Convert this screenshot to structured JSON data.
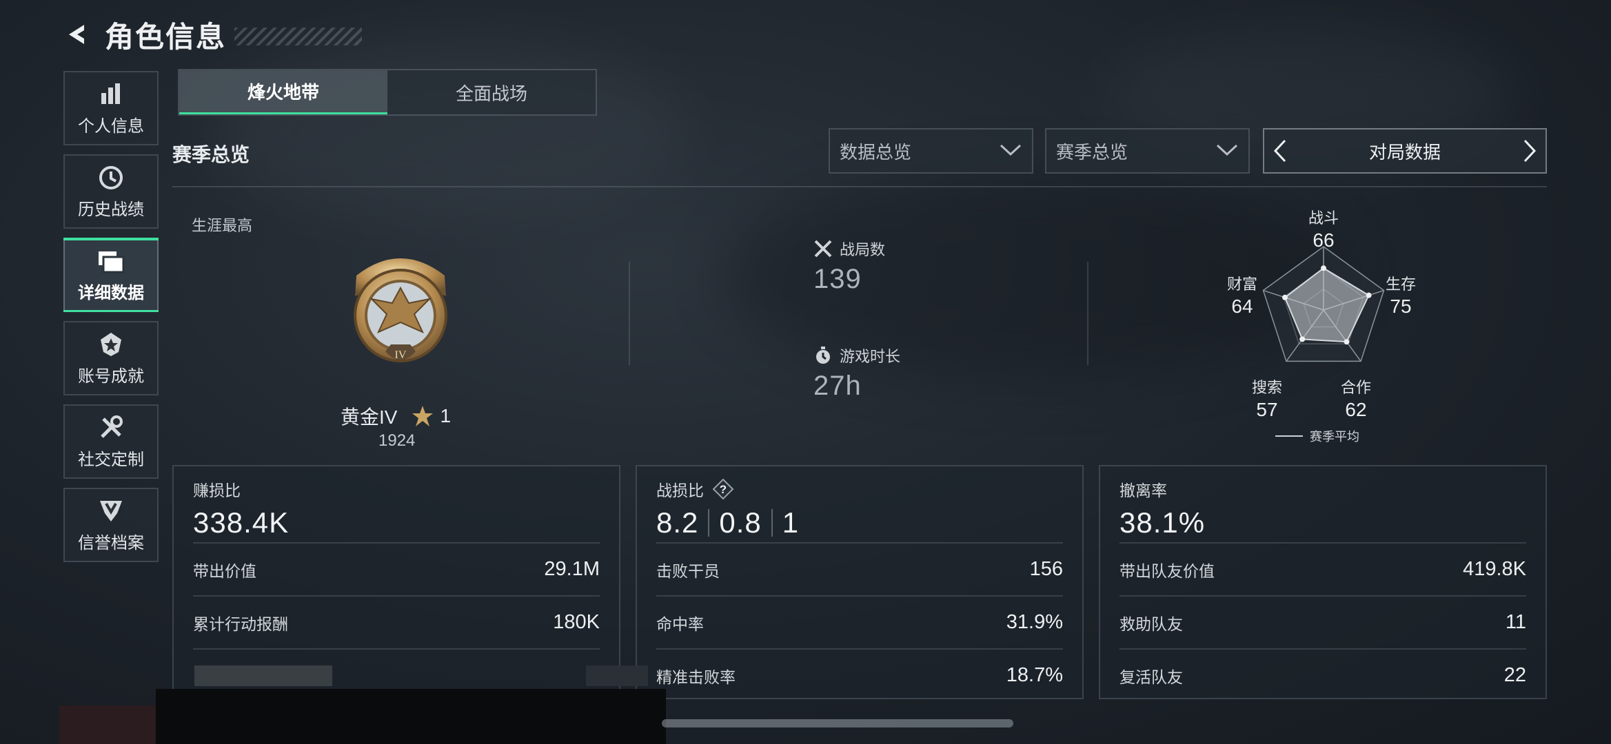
{
  "header": {
    "title": "角色信息"
  },
  "sidebar": {
    "items": [
      {
        "label": "个人信息",
        "icon": "bar-chart-icon"
      },
      {
        "label": "历史战绩",
        "icon": "history-clock-icon"
      },
      {
        "label": "详细数据",
        "icon": "folders-icon",
        "active": true
      },
      {
        "label": "账号成就",
        "icon": "achievement-badge-icon"
      },
      {
        "label": "社交定制",
        "icon": "tools-icon"
      },
      {
        "label": "信誉档案",
        "icon": "reputation-shield-icon"
      }
    ]
  },
  "tabs": [
    {
      "label": "烽火地带",
      "active": true
    },
    {
      "label": "全面战场",
      "active": false
    }
  ],
  "section": {
    "title": "赛季总览"
  },
  "filters": {
    "data_overview": "数据总览",
    "season_overview": "赛季总览",
    "pager_label": "对局数据"
  },
  "career": {
    "label": "生涯最高",
    "rank": "黄金IV",
    "stars": "1",
    "score": "1924",
    "medal_numeral": "IV"
  },
  "battles": {
    "matches_label": "战局数",
    "matches_value": "139",
    "time_label": "游戏时长",
    "time_value": "27h"
  },
  "radar": {
    "legend": "赛季平均",
    "axes": [
      {
        "name": "战斗",
        "value": "66",
        "score": 66
      },
      {
        "name": "生存",
        "value": "75",
        "score": 75
      },
      {
        "name": "合作",
        "value": "62",
        "score": 62
      },
      {
        "name": "搜索",
        "value": "57",
        "score": 57
      },
      {
        "name": "财富",
        "value": "64",
        "score": 64
      }
    ]
  },
  "cards": {
    "profit": {
      "title": "赚损比",
      "main": "338.4K",
      "rows": [
        {
          "k": "带出价值",
          "v": "29.1M"
        },
        {
          "k": "累计行动报酬",
          "v": "180K"
        }
      ]
    },
    "kd": {
      "title": "战损比",
      "main_a": "8.2",
      "main_b": "0.8",
      "main_c": "1",
      "help": "?",
      "rows": [
        {
          "k": "击败干员",
          "v": "156"
        },
        {
          "k": "命中率",
          "v": "31.9%"
        },
        {
          "k": "精准击败率",
          "v": "18.7%"
        }
      ]
    },
    "extract": {
      "title": "撤离率",
      "main": "38.1%",
      "rows": [
        {
          "k": "带出队友价值",
          "v": "419.8K"
        },
        {
          "k": "救助队友",
          "v": "11"
        },
        {
          "k": "复活队友",
          "v": "22"
        }
      ]
    }
  },
  "colors": {
    "accent": "#3fe0a0",
    "gold": "#c9a463"
  }
}
